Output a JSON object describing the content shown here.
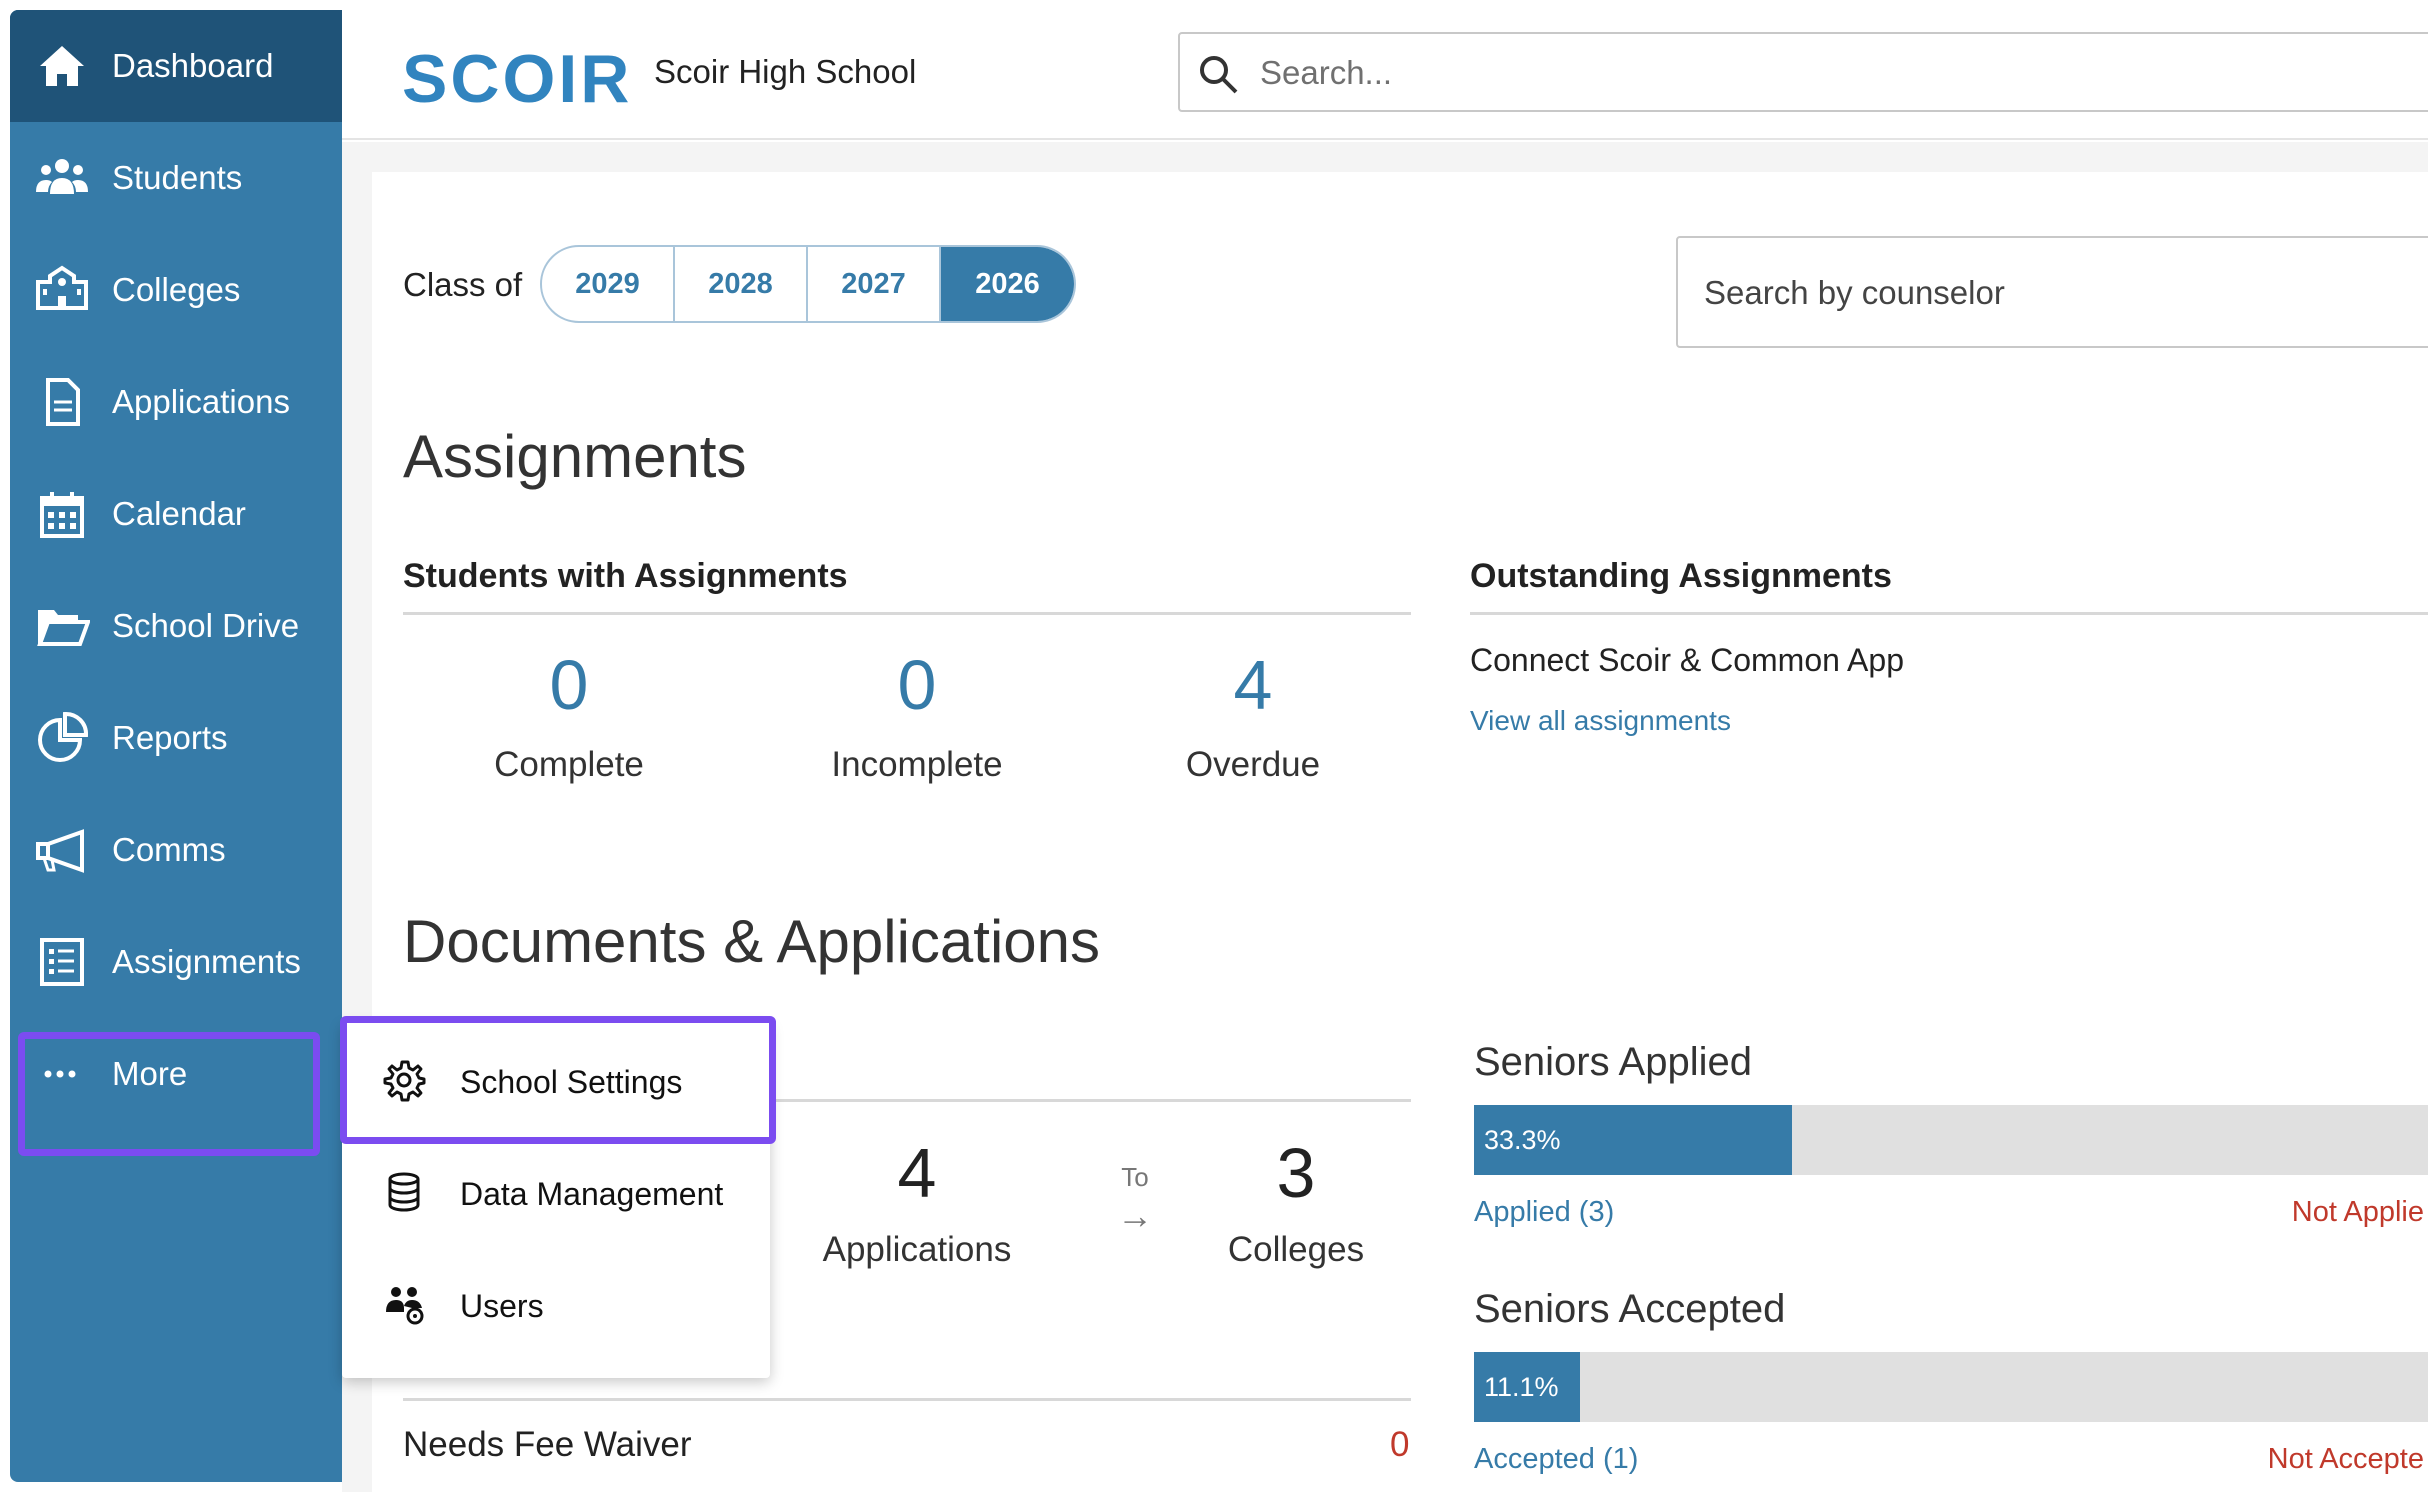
{
  "sidebar": {
    "items": [
      {
        "label": "Dashboard",
        "icon": "home-icon"
      },
      {
        "label": "Students",
        "icon": "students-icon"
      },
      {
        "label": "Colleges",
        "icon": "colleges-icon"
      },
      {
        "label": "Applications",
        "icon": "document-icon"
      },
      {
        "label": "Calendar",
        "icon": "calendar-icon"
      },
      {
        "label": "School Drive",
        "icon": "folder-icon"
      },
      {
        "label": "Reports",
        "icon": "pie-chart-icon"
      },
      {
        "label": "Comms",
        "icon": "megaphone-icon"
      },
      {
        "label": "Assignments",
        "icon": "checklist-icon"
      },
      {
        "label": "More",
        "icon": "more-dots-icon"
      }
    ]
  },
  "header": {
    "logo": "SCOIR",
    "school_name": "Scoir High School",
    "search_placeholder": "Search..."
  },
  "filters": {
    "class_of_label": "Class of",
    "years": [
      "2029",
      "2028",
      "2027",
      "2026"
    ],
    "selected_year": "2026",
    "counselor_placeholder": "Search by counselor"
  },
  "assignments": {
    "title": "Assignments",
    "students_with": {
      "title": "Students with Assignments",
      "stats": [
        {
          "value": "0",
          "label": "Complete"
        },
        {
          "value": "0",
          "label": "Incomplete"
        },
        {
          "value": "4",
          "label": "Overdue"
        }
      ]
    },
    "outstanding": {
      "title": "Outstanding Assignments",
      "item": "Connect Scoir & Common App",
      "view_all": "View all assignments"
    }
  },
  "documents": {
    "title": "Documents & Applications",
    "applications": {
      "value": "4",
      "label": "Applications"
    },
    "to_label": "To",
    "colleges": {
      "value": "3",
      "label": "Colleges"
    },
    "fee_waiver": {
      "label": "Needs Fee Waiver",
      "value": "0"
    },
    "seniors_applied": {
      "title": "Seniors Applied",
      "percent_label": "33.3%",
      "fraction": 0.333,
      "left_legend": "Applied (3)",
      "right_legend": "Not Applie"
    },
    "seniors_accepted": {
      "title": "Seniors Accepted",
      "percent_label": "11.1%",
      "fraction": 0.111,
      "left_legend": "Accepted (1)",
      "right_legend": "Not Accepte"
    }
  },
  "more_menu": {
    "items": [
      {
        "label": "School Settings",
        "icon": "gear-icon"
      },
      {
        "label": "Data Management",
        "icon": "database-icon"
      },
      {
        "label": "Users",
        "icon": "users-gear-icon"
      }
    ]
  },
  "colors": {
    "sidebar": "#367ba8",
    "sidebar_active": "#1f5378",
    "accent": "#367ba8",
    "highlight": "#7b4cf0",
    "negative": "#c0392b"
  }
}
